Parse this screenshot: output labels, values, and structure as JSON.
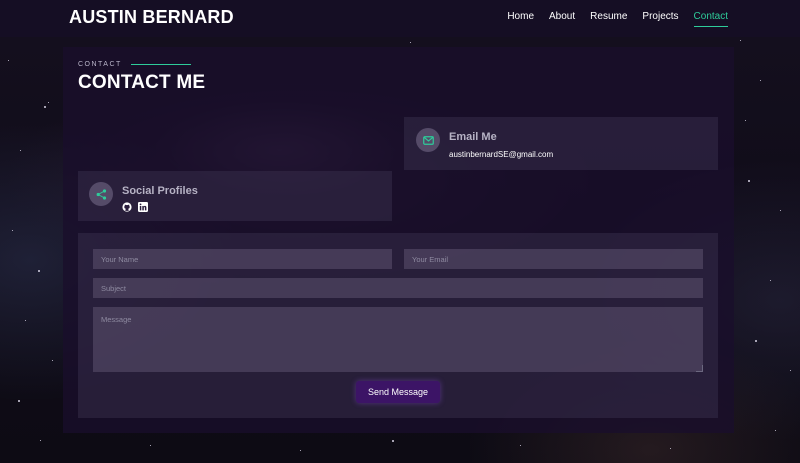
{
  "header": {
    "logo": "AUSTIN BERNARD",
    "nav": [
      {
        "label": "Home",
        "active": false
      },
      {
        "label": "About",
        "active": false
      },
      {
        "label": "Resume",
        "active": false
      },
      {
        "label": "Projects",
        "active": false
      },
      {
        "label": "Contact",
        "active": true
      }
    ]
  },
  "section": {
    "subtitle": "CONTACT",
    "title": "CONTACT ME"
  },
  "email_card": {
    "icon": "envelope-icon",
    "title": "Email Me",
    "email": "austinbernardSE@gmail.com"
  },
  "social_card": {
    "icon": "share-icon",
    "title": "Social Profiles",
    "links": [
      "github-icon",
      "linkedin-icon"
    ]
  },
  "form": {
    "name_placeholder": "Your Name",
    "email_placeholder": "Your Email",
    "subject_placeholder": "Subject",
    "message_placeholder": "Message",
    "submit_label": "Send Message"
  },
  "colors": {
    "accent": "#2ecc9a",
    "button": "#3c1466"
  }
}
